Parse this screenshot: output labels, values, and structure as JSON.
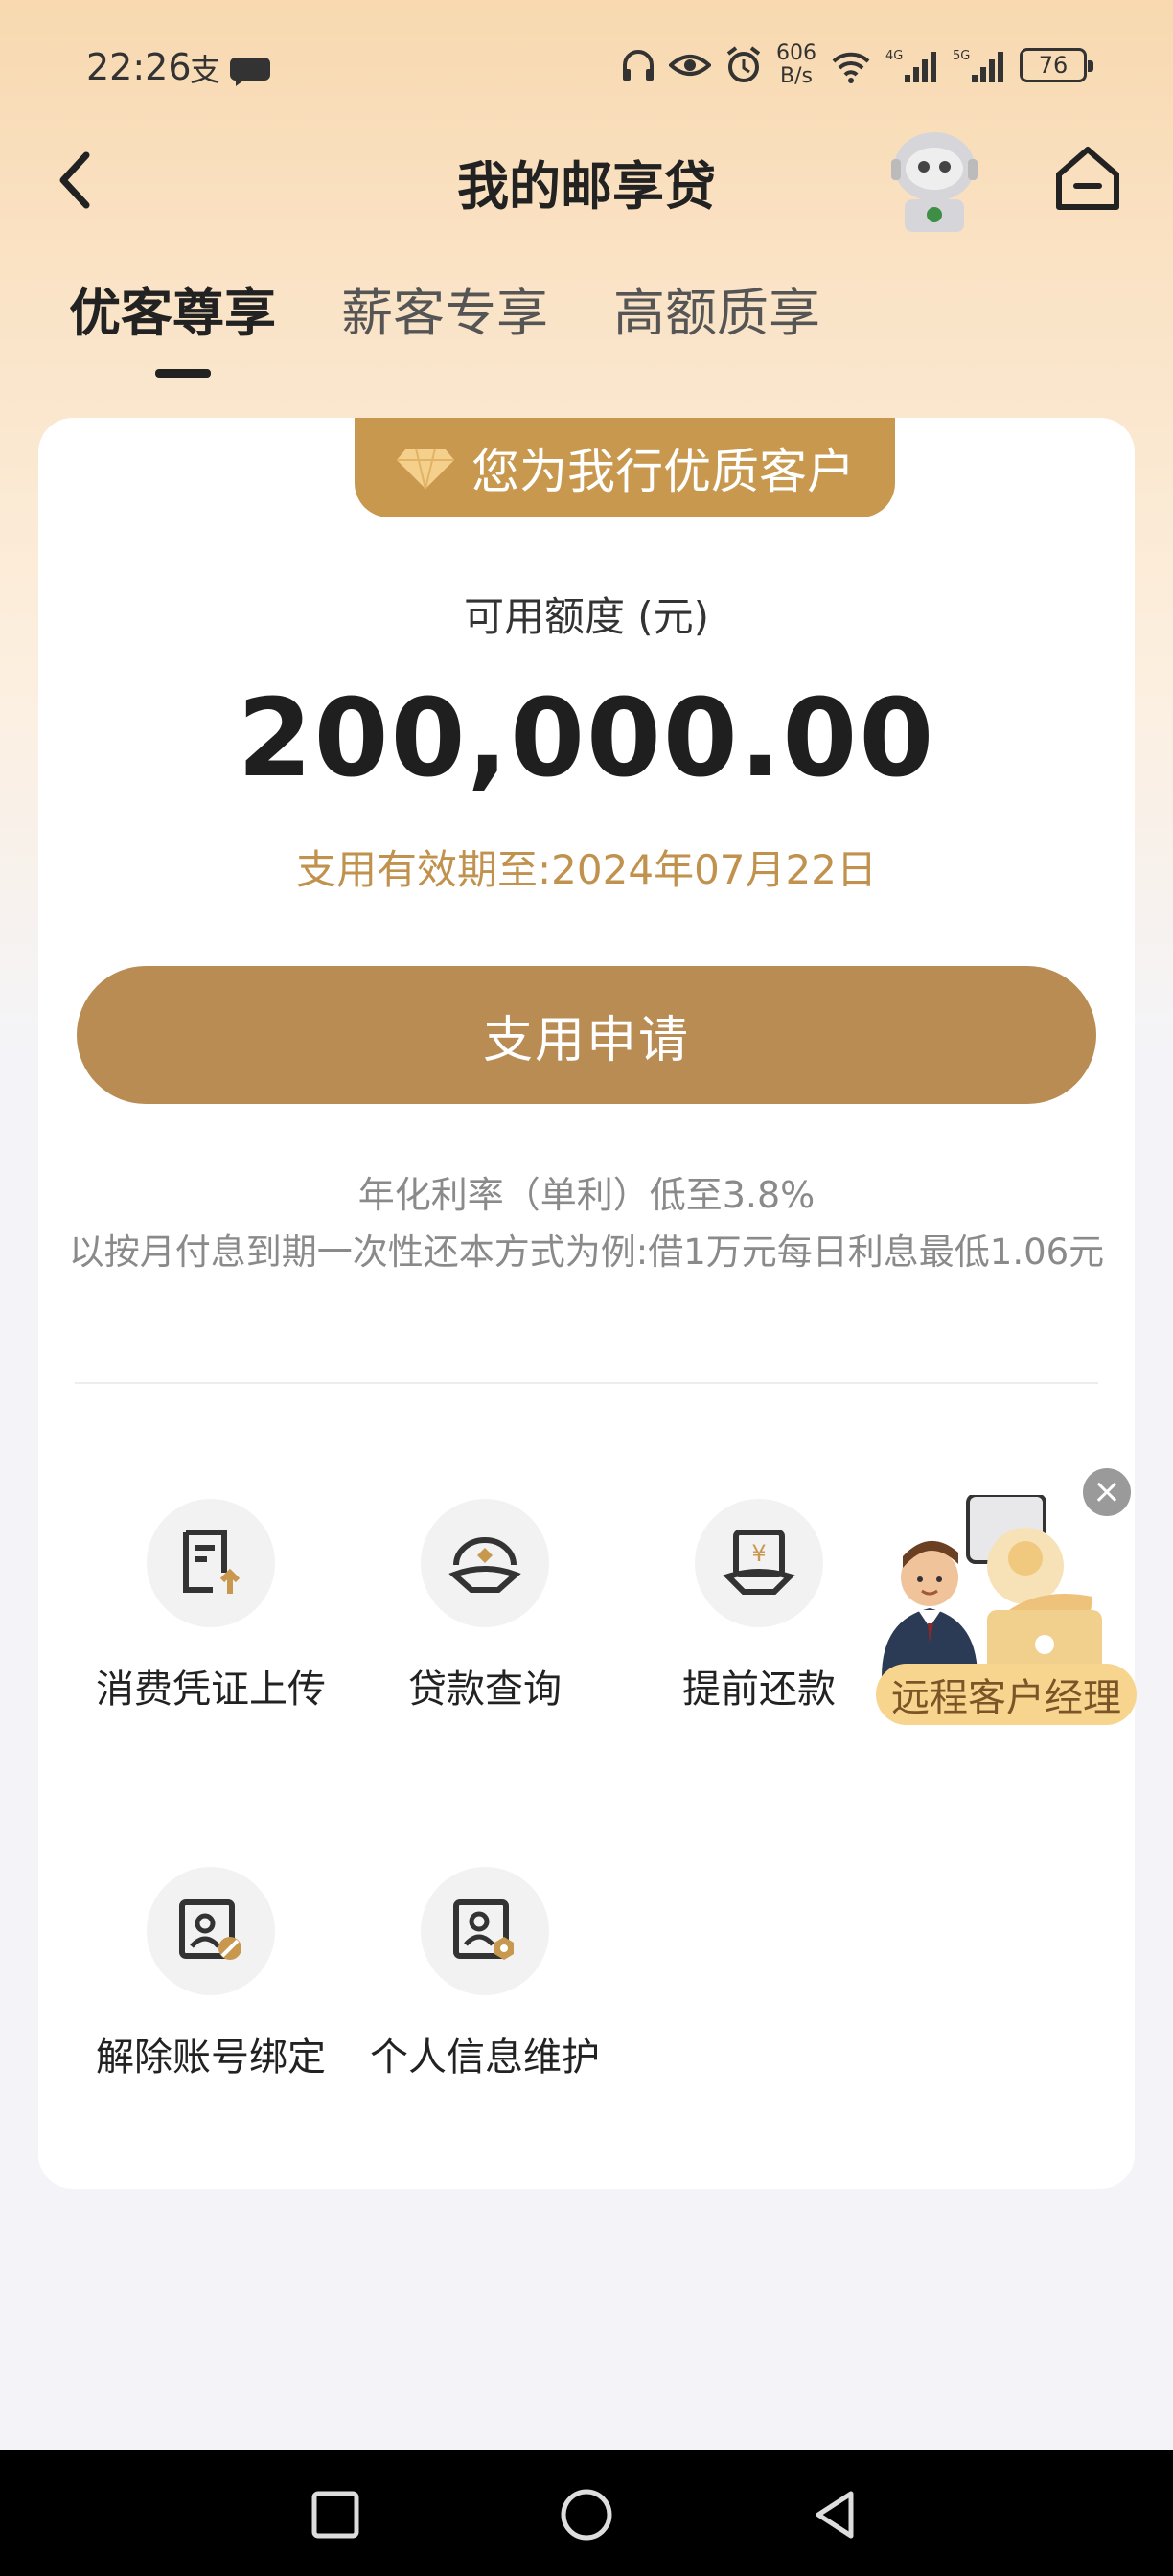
{
  "status_bar": {
    "time": "22:26",
    "net_speed_value": "606",
    "net_speed_unit": "B/s",
    "battery": "76"
  },
  "header": {
    "title": "我的邮享贷"
  },
  "tabs": [
    {
      "label": "优客尊享",
      "active": true
    },
    {
      "label": "薪客专享",
      "active": false
    },
    {
      "label": "高额质享",
      "active": false
    }
  ],
  "card": {
    "badge_text": "您为我行优质客户",
    "credit_label": "可用额度 (元)",
    "credit_amount": "200,000.00",
    "validity": "支用有效期至:2024年07月22日",
    "apply_button": "支用申请",
    "rate_text": "年化利率（单利）低至3.8%",
    "rate_example": "以按月付息到期一次性还本方式为例:借1万元每日利息最低1.06元"
  },
  "features": [
    {
      "label": "消费凭证上传",
      "icon": "document-upload-icon"
    },
    {
      "label": "贷款查询",
      "icon": "loan-query-icon"
    },
    {
      "label": "提前还款",
      "icon": "early-repayment-icon"
    },
    {
      "label": "解除账号绑定",
      "icon": "unbind-account-icon"
    },
    {
      "label": "个人信息维护",
      "icon": "personal-info-icon"
    }
  ],
  "floating": {
    "manager_label": "远程客户经理",
    "close_symbol": "×"
  },
  "colors": {
    "accent": "#b98c53",
    "badge": "#c8984f",
    "validity_text": "#c0924d"
  }
}
